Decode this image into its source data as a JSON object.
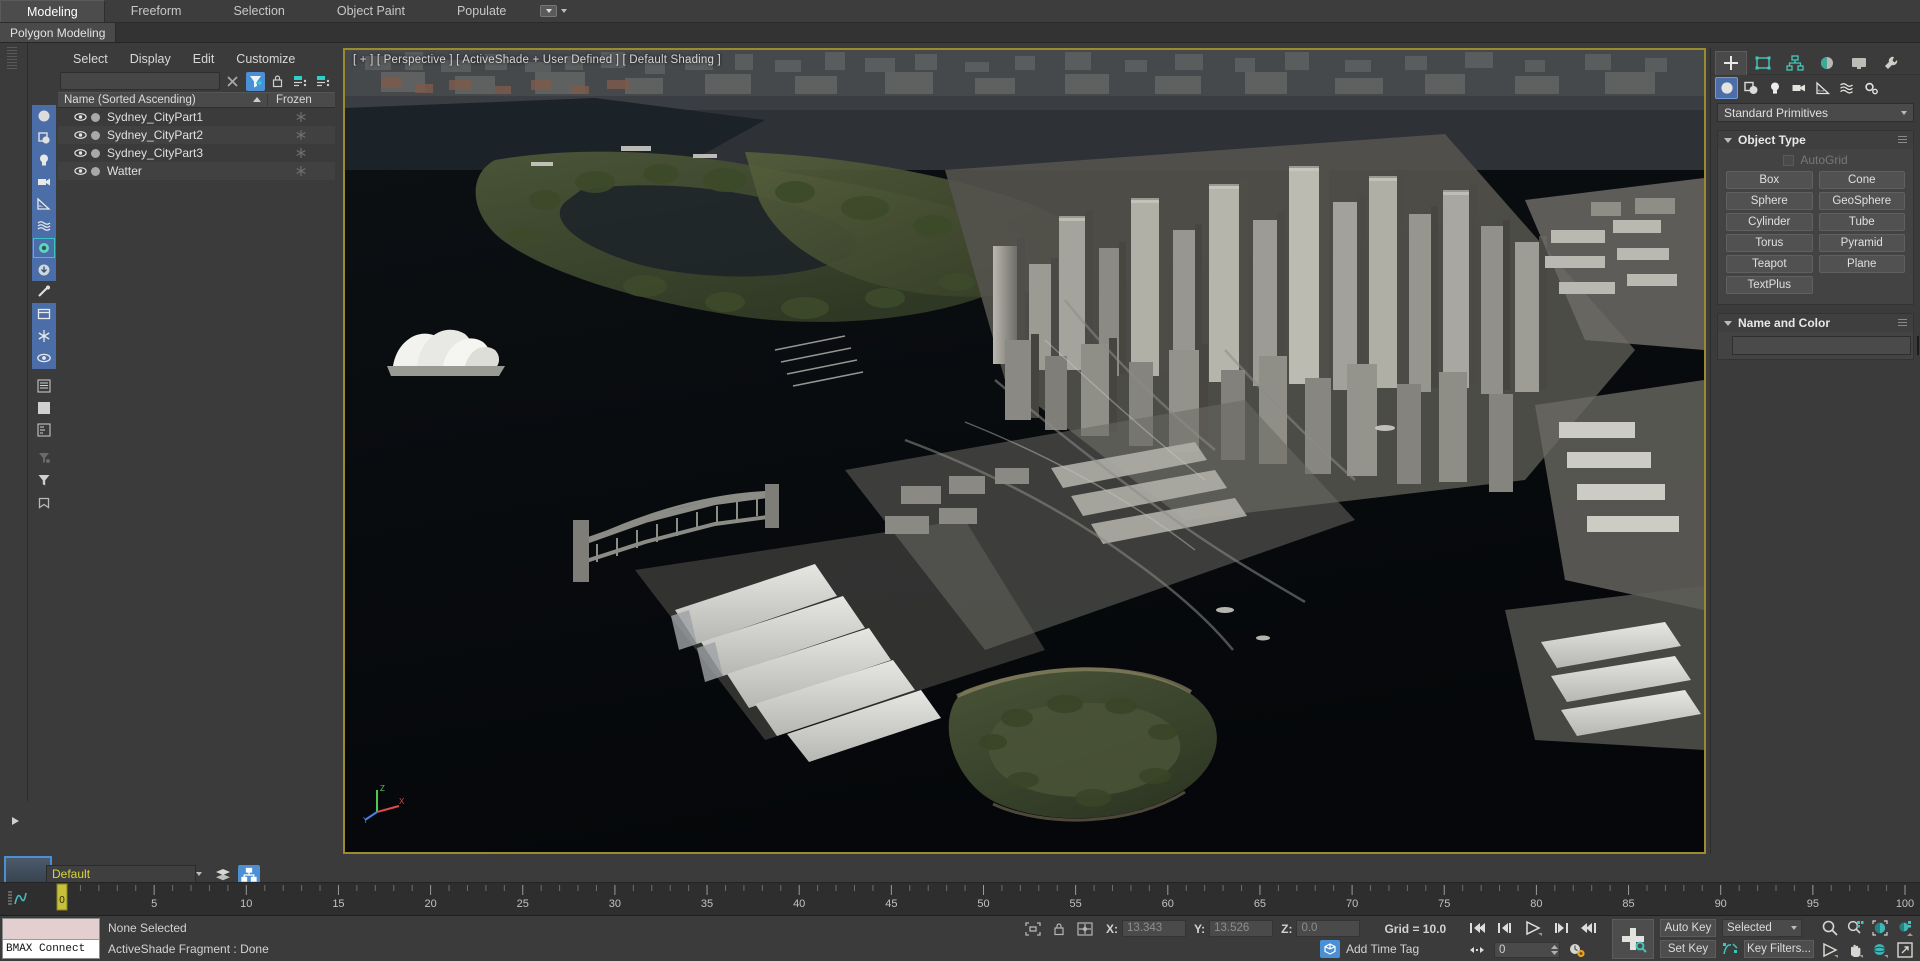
{
  "ribbon": {
    "tabs": [
      {
        "label": "Modeling",
        "active": true
      },
      {
        "label": "Freeform",
        "active": false
      },
      {
        "label": "Selection",
        "active": false
      },
      {
        "label": "Object Paint",
        "active": false
      },
      {
        "label": "Populate",
        "active": false
      }
    ],
    "subtab": "Polygon Modeling"
  },
  "explorer": {
    "menus": [
      "Select",
      "Display",
      "Edit",
      "Customize"
    ],
    "search_value": "",
    "columns": {
      "name": "Name (Sorted Ascending)",
      "frozen": "Frozen"
    },
    "rows": [
      {
        "name": "Sydney_CityPart1",
        "visible": true,
        "frozen": false
      },
      {
        "name": "Sydney_CityPart2",
        "visible": true,
        "frozen": false
      },
      {
        "name": "Sydney_CityPart3",
        "visible": true,
        "frozen": false
      },
      {
        "name": "Watter",
        "visible": true,
        "frozen": false
      }
    ]
  },
  "viewport": {
    "label": "[ + ] [ Perspective ] [ ActiveShade + User Defined ] [ Default Shading ]",
    "border_color": "#9b8b2e",
    "axis": {
      "x": "X",
      "y": "Y",
      "z": "Z"
    }
  },
  "command_panel": {
    "tabs": [
      "create-tab",
      "modify-tab",
      "hierarchy-tab",
      "motion-tab",
      "display-tab",
      "utilities-tab"
    ],
    "active_tab": "create-tab",
    "subtabs": [
      "geometry-icon",
      "shapes-icon",
      "lights-icon",
      "cameras-icon",
      "helpers-icon",
      "spacewarps-icon",
      "systems-icon"
    ],
    "category": "Standard Primitives",
    "object_type": {
      "title": "Object Type",
      "autogrid_label": "AutoGrid",
      "autogrid_checked": false,
      "buttons": [
        "Box",
        "Cone",
        "Sphere",
        "GeoSphere",
        "Cylinder",
        "Tube",
        "Torus",
        "Pyramid",
        "Teapot",
        "Plane",
        "TextPlus"
      ]
    },
    "name_and_color": {
      "title": "Name and Color",
      "name_value": "",
      "color": "#e0359b"
    }
  },
  "layer_bar": {
    "layer_name": "Default",
    "frame_counter": "0 / 100",
    "prev_label": "<",
    "next_label": ">"
  },
  "timeline": {
    "current_frame": "0",
    "start": 0,
    "end": 100,
    "major_step": 5,
    "labels": [
      "0",
      "5",
      "10",
      "15",
      "20",
      "25",
      "30",
      "35",
      "40",
      "45",
      "50",
      "55",
      "60",
      "65",
      "70",
      "75",
      "80",
      "85",
      "90",
      "95",
      "100"
    ]
  },
  "status_bar": {
    "maxscript_mini": "BMAX Connect",
    "selection_status": "None Selected",
    "prompt": "ActiveShade Fragment : Done",
    "coords": {
      "x_label": "X:",
      "x_value": "13.343",
      "y_label": "Y:",
      "y_value": "13.526",
      "z_label": "Z:",
      "z_value": "0.0"
    },
    "grid_label": "Grid = 10.0",
    "add_time_tag": "Add Time Tag"
  },
  "animation": {
    "frame_value": "0",
    "auto_key": "Auto Key",
    "set_key": "Set Key",
    "key_filters": "Key Filters...",
    "key_mode": "Selected"
  }
}
